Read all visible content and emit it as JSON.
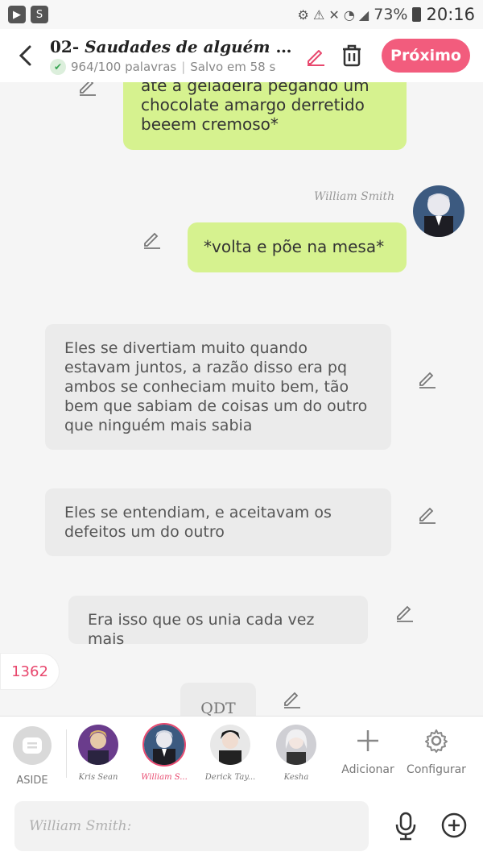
{
  "status_bar": {
    "battery": "73%",
    "time": "20:16"
  },
  "header": {
    "title_number": "02-",
    "title_text": "Saudades de alguém desco...",
    "word_count": "964/100 palavras",
    "save_status": "Salvo em 58 s",
    "next_label": "Próximo"
  },
  "messages": [
    {
      "type": "user",
      "text": "até a geladeira pegando um chocolate amargo derretido beeem cremoso*"
    },
    {
      "type": "user",
      "author": "William Smith",
      "text": "*volta e põe na mesa*"
    },
    {
      "type": "narration",
      "text": "Eles se divertiam muito quando estavam juntos, a razão disso era pq ambos se conheciam muito bem, tão bem que sabiam de coisas um do outro que ninguém mais sabia"
    },
    {
      "type": "narration",
      "text": "Eles se entendiam, e aceitavam os defeitos um do outro"
    },
    {
      "type": "narration",
      "text": "Era isso que os unia cada vez mais"
    },
    {
      "type": "narration",
      "text": "QDT"
    }
  ],
  "count_badge": "1362",
  "characters": {
    "aside_label": "ASIDE",
    "list": [
      {
        "name": "Kris Sean",
        "active": false
      },
      {
        "name": "William S...",
        "active": true
      },
      {
        "name": "Derick Tay...",
        "active": false
      },
      {
        "name": "Kesha",
        "active": false
      }
    ],
    "add_label": "Adicionar",
    "config_label": "Configurar"
  },
  "input": {
    "placeholder": "William Smith:"
  },
  "colors": {
    "accent": "#f25c7d",
    "user_bubble": "#d6f28f",
    "narration_bubble": "#ebebeb"
  }
}
